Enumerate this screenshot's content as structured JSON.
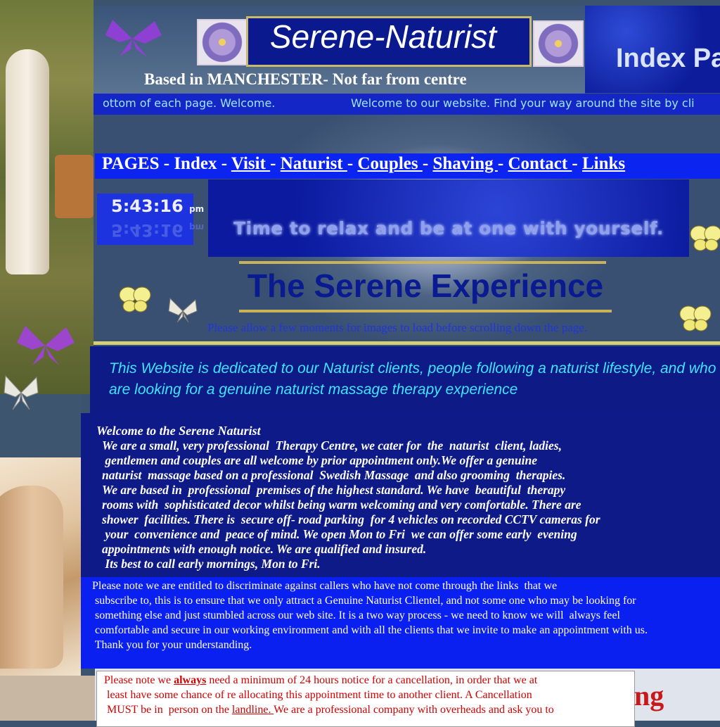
{
  "header": {
    "title": "Serene-Naturist",
    "subtitle": "Based in MANCHESTER- Not far from centre",
    "index_page": "Index Pa"
  },
  "marquee": {
    "text_left": "ottom of each page. Welcome.",
    "text_right": "Welcome to our website. Find your way around the site by cli"
  },
  "nav": {
    "prefix": "PAGES - ",
    "index": "Index",
    "sep": " - ",
    "visit": "Visit ",
    "naturist": "Naturist ",
    "couples": "Couples ",
    "shaving": "Shaving  ",
    "contact": "Contact ",
    "links": "Links"
  },
  "clock": {
    "time": "5:43:16",
    "ampm": "pm"
  },
  "relax_text": "Time to relax and be at one with yourself.",
  "experience_heading": "The Serene Experience",
  "load_note": "Please allow a few moments for images to load before scrolling down the page.",
  "dedication": "This Website is dedicated to our Naturist clients, people following a naturist lifestyle, and who are looking for a genuine naturist massage therapy experience",
  "welcome": {
    "title": "Welcome to the Serene Naturist",
    "body": "We are a small, very professional  Therapy Centre, we cater for  the  naturist  client, ladies,\n gentlemen and couples are all welcome by prior appointment only.We offer a genuine\nnaturist  massage based on a professional  Swedish Massage  and also grooming  therapies.\nWe are based in  professional  premises of the highest standard. We have  beautiful  therapy\nrooms with  sophisticated decor whilst being warm welcoming and very comfortable. There are\nshower  facilities. There is  secure off- road parking  for 4 vehicles on recorded CCTV cameras for\n your  convenience and  peace of mind. We open Mon to Fri  we can offer some early  evening\nappointments with enough notice. We are qualified and insured.\n Its best to call early mornings, Mon to Fri."
  },
  "note": "Please note we are entitled to discriminate against callers who have not come through the links  that we\n subscribe to, this is to ensure that we only attract a Genuine Naturist Clientel, and not some one who may be looking for\n something else and just stumbled across our web site. It is a two way process - we need to know we will  always feel\n comfortable and secure in our working environment and with all the clients that we invite to make an appointment with us.\n Thank you for your understanding.",
  "cancellation": {
    "part1": "Please note we ",
    "always": "always",
    "part2": " need a minimum of 24 hours notice for a cancellation, in order that we at\n least have some chance of re allocating this appointment time to another client. A Cancellation\n MUST be in  person on the ",
    "landline": "landline. ",
    "part3": "We are a professional company with overheads and ask you to"
  },
  "partial_heading": "ng",
  "colors": {
    "nav_bg": "#0b24f0",
    "dark_panel": "#0d1a87",
    "accent_cyan": "#40e4ff",
    "cancel_red": "#d40000"
  }
}
